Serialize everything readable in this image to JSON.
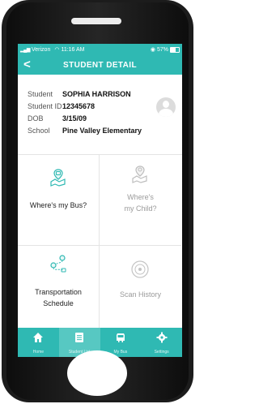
{
  "status_bar": {
    "carrier": "Verizon",
    "time": "11:16 AM",
    "battery": "57%"
  },
  "nav": {
    "back_label": "<",
    "title": "STUDENT DETAIL"
  },
  "student": {
    "name_label": "Student",
    "name": "SOPHIA HARRISON",
    "id_label": "Student ID",
    "id": "12345678",
    "dob_label": "DOB",
    "dob": "3/15/09",
    "school_label": "School",
    "school": "Pine Valley Elementary"
  },
  "tiles": [
    {
      "label": "Where's my Bus?",
      "icon": "bus-map-icon",
      "enabled": true
    },
    {
      "label_line1": "Where's",
      "label_line2": "my Child?",
      "icon": "child-map-icon",
      "enabled": false
    },
    {
      "label_line1": "Transportation",
      "label_line2": "Schedule",
      "icon": "route-icon",
      "enabled": true
    },
    {
      "label": "Scan History",
      "icon": "scan-history-icon",
      "enabled": false
    }
  ],
  "tabbar": {
    "items": [
      {
        "label": "Home",
        "icon": "home-icon"
      },
      {
        "label": "Student List",
        "icon": "student-list-icon",
        "active": true
      },
      {
        "label": "My Bus",
        "icon": "bus-icon"
      },
      {
        "label": "Settings",
        "icon": "gear-icon"
      }
    ]
  },
  "colors": {
    "accent": "#2fb9b3",
    "accent_active": "#57c8c2",
    "disabled_text": "#9a9a9a"
  }
}
